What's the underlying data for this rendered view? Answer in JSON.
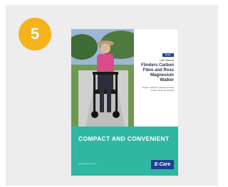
{
  "step": {
    "number": "5"
  },
  "brochure": {
    "brand_tag": "Ecare",
    "subtitle": "User Manual",
    "title": "Flinders Carbon Fibre and Ross Magnesium Walker",
    "note": "Please read this manual carefully before using the product",
    "headline": "COMPACT AND CONVENIENT",
    "footer_note": "www.ecare.com.au",
    "logo": "E-Care"
  },
  "colors": {
    "badge": "#f5b21b",
    "teal": "#2fb7a3",
    "navy": "#1f3f8f",
    "card_bg": "#ededed"
  },
  "icons": [
    "step-number-badge",
    "ecare-logo"
  ]
}
